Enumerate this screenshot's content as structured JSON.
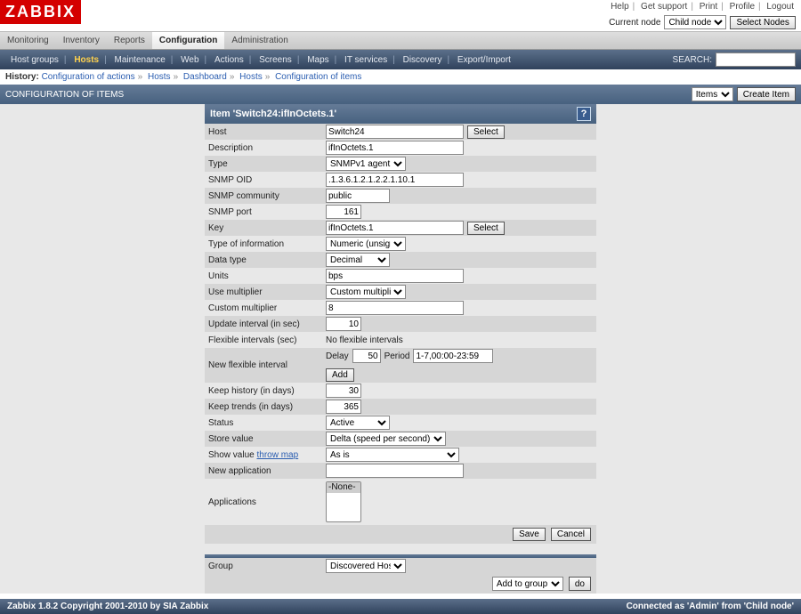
{
  "logo": "ZABBIX",
  "toplinks": [
    "Help",
    "Get support",
    "Print",
    "Profile",
    "Logout"
  ],
  "nodebar": {
    "label": "Current node",
    "selected": "Child node",
    "button": "Select Nodes"
  },
  "nav": {
    "items": [
      "Monitoring",
      "Inventory",
      "Reports",
      "Configuration",
      "Administration"
    ],
    "active": "Configuration"
  },
  "subnav": {
    "items": [
      "Host groups",
      "Hosts",
      "Maintenance",
      "Web",
      "Actions",
      "Screens",
      "Maps",
      "IT services",
      "Discovery",
      "Export/Import"
    ],
    "active": "Hosts",
    "search_label": "SEARCH:"
  },
  "history": {
    "label": "History:",
    "items": [
      "Configuration of actions",
      "Hosts",
      "Dashboard",
      "Hosts",
      "Configuration of items"
    ]
  },
  "section": {
    "title": "CONFIGURATION OF ITEMS",
    "dropdown": "Items",
    "button": "Create Item"
  },
  "form": {
    "title": "Item 'Switch24:ifInOctets.1'",
    "rows": [
      {
        "k": "host",
        "label": "Host",
        "type": "text_button",
        "value": "Switch24",
        "button": "Select"
      },
      {
        "k": "description",
        "label": "Description",
        "type": "text",
        "value": "ifInOctets.1"
      },
      {
        "k": "type",
        "label": "Type",
        "type": "select",
        "value": "SNMPv1 agent"
      },
      {
        "k": "snmp_oid",
        "label": "SNMP OID",
        "type": "text",
        "value": ".1.3.6.1.2.1.2.2.1.10.1"
      },
      {
        "k": "snmp_community",
        "label": "SNMP community",
        "type": "text_short",
        "value": "public"
      },
      {
        "k": "snmp_port",
        "label": "SNMP port",
        "type": "num",
        "value": "161"
      },
      {
        "k": "key",
        "label": "Key",
        "type": "text_button",
        "value": "ifInOctets.1",
        "button": "Select"
      },
      {
        "k": "type_info",
        "label": "Type of information",
        "type": "select",
        "value": "Numeric (unsigned)"
      },
      {
        "k": "data_type",
        "label": "Data type",
        "type": "select_short",
        "value": "Decimal"
      },
      {
        "k": "units",
        "label": "Units",
        "type": "text",
        "value": "bps"
      },
      {
        "k": "use_multiplier",
        "label": "Use multiplier",
        "type": "select",
        "value": "Custom multiplier"
      },
      {
        "k": "custom_multiplier",
        "label": "Custom multiplier",
        "type": "text",
        "value": "8"
      },
      {
        "k": "update_interval",
        "label": "Update interval (in sec)",
        "type": "num",
        "value": "10"
      },
      {
        "k": "flex_intervals",
        "label": "Flexible intervals (sec)",
        "type": "static",
        "value": "No flexible intervals"
      },
      {
        "k": "new_flex",
        "label": "New flexible interval",
        "type": "flex",
        "delay_label": "Delay",
        "delay": "50",
        "period_label": "Period",
        "period": "1-7,00:00-23:59",
        "add": "Add"
      },
      {
        "k": "keep_history",
        "label": "Keep history (in days)",
        "type": "num",
        "value": "30"
      },
      {
        "k": "keep_trends",
        "label": "Keep trends (in days)",
        "type": "num",
        "value": "365"
      },
      {
        "k": "status",
        "label": "Status",
        "type": "select_short",
        "value": "Active"
      },
      {
        "k": "store_value",
        "label": "Store value",
        "type": "select_wide",
        "value": "Delta (speed per second)"
      },
      {
        "k": "show_value",
        "label": "Show value",
        "type": "show_value",
        "value": "As is",
        "link": "throw map"
      },
      {
        "k": "new_application",
        "label": "New application",
        "type": "text",
        "value": ""
      },
      {
        "k": "applications",
        "label": "Applications",
        "type": "list",
        "option": "-None-"
      }
    ],
    "actions": {
      "save": "Save",
      "cancel": "Cancel"
    }
  },
  "group_form": {
    "label": "Group",
    "select": "Discovered Hosts",
    "add_label": "Add to group",
    "do": "do"
  },
  "footer": {
    "left": "Zabbix 1.8.2 Copyright 2001-2010 by SIA Zabbix",
    "right": "Connected as 'Admin' from 'Child node'"
  }
}
